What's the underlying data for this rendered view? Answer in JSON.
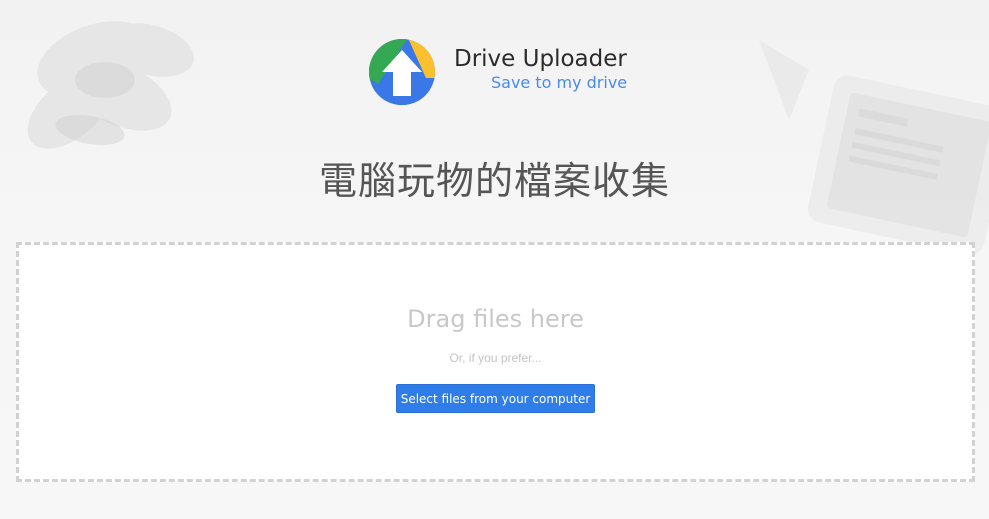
{
  "header": {
    "title": "Drive Uploader",
    "subtitle": "Save to my drive",
    "logo_icon": "drive-upload-arrow-icon"
  },
  "page_title": "電腦玩物的檔案收集",
  "dropzone": {
    "drag_text": "Drag files here",
    "or_text": "Or, if you prefer...",
    "select_button_label": "Select files from your computer"
  },
  "colors": {
    "accent": "#2f7de8",
    "subtitle": "#4a8af0",
    "logo_green": "#34a853",
    "logo_yellow": "#fbc02d",
    "logo_blue": "#3b78e7"
  }
}
